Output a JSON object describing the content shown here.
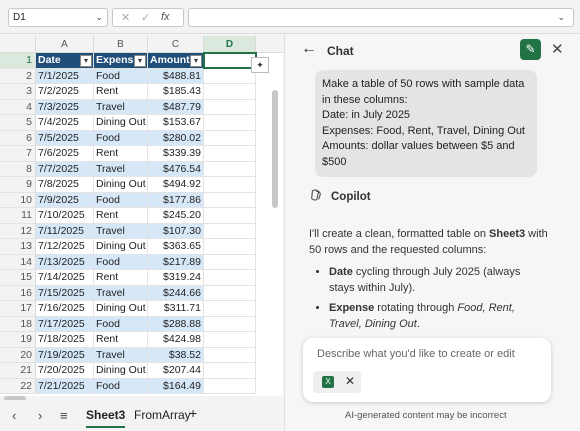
{
  "formula_bar": {
    "name_box": "D1",
    "fx_label": "fx",
    "formula": ""
  },
  "grid": {
    "col_headers": [
      "A",
      "B",
      "C",
      "D"
    ],
    "table_headers": [
      "Date",
      "Expense",
      "Amount"
    ],
    "rows": [
      [
        "7/1/2025",
        "Food",
        "$488.81"
      ],
      [
        "7/2/2025",
        "Rent",
        "$185.43"
      ],
      [
        "7/3/2025",
        "Travel",
        "$487.79"
      ],
      [
        "7/4/2025",
        "Dining Out",
        "$153.67"
      ],
      [
        "7/5/2025",
        "Food",
        "$280.02"
      ],
      [
        "7/6/2025",
        "Rent",
        "$339.39"
      ],
      [
        "7/7/2025",
        "Travel",
        "$476.54"
      ],
      [
        "7/8/2025",
        "Dining Out",
        "$494.92"
      ],
      [
        "7/9/2025",
        "Food",
        "$177.86"
      ],
      [
        "7/10/2025",
        "Rent",
        "$245.20"
      ],
      [
        "7/11/2025",
        "Travel",
        "$107.30"
      ],
      [
        "7/12/2025",
        "Dining Out",
        "$363.65"
      ],
      [
        "7/13/2025",
        "Food",
        "$217.89"
      ],
      [
        "7/14/2025",
        "Rent",
        "$319.24"
      ],
      [
        "7/15/2025",
        "Travel",
        "$244.66"
      ],
      [
        "7/16/2025",
        "Dining Out",
        "$311.71"
      ],
      [
        "7/17/2025",
        "Food",
        "$288.88"
      ],
      [
        "7/18/2025",
        "Rent",
        "$424.98"
      ],
      [
        "7/19/2025",
        "Travel",
        "$38.52"
      ],
      [
        "7/20/2025",
        "Dining Out",
        "$207.44"
      ],
      [
        "7/21/2025",
        "Food",
        "$164.49"
      ]
    ]
  },
  "sheet_tabs": {
    "active": "Sheet3",
    "other": "FromArray",
    "add": "+"
  },
  "chat": {
    "title": "Chat",
    "user_message": [
      "Make a table of 50 rows with sample data",
      "in these columns:",
      "Date: in July 2025",
      "Expenses: Food, Rent, Travel, Dining Out",
      "Amounts: dollar values between $5 and",
      "$500"
    ],
    "assistant_name": "Copilot",
    "reply_intro_1": "I'll create a clean, formatted table on ",
    "reply_intro_sheet": "Sheet3",
    "reply_intro_2": " with 50 rows and the requested columns:",
    "bullets": [
      {
        "bold": "Date",
        "text": " cycling through July 2025 (always stays within July)."
      },
      {
        "bold": "Expense",
        "text": " rotating through ",
        "italic": "Food, Rent, Travel, Dining Out",
        "tail": "."
      }
    ],
    "composer_placeholder": "Describe what you'd like to create or edit",
    "disclaimer": "AI-generated content may be incorrect"
  },
  "colors": {
    "accent": "#217346",
    "header_fill": "#1f4e79",
    "band_fill": "#d6e8f7"
  }
}
